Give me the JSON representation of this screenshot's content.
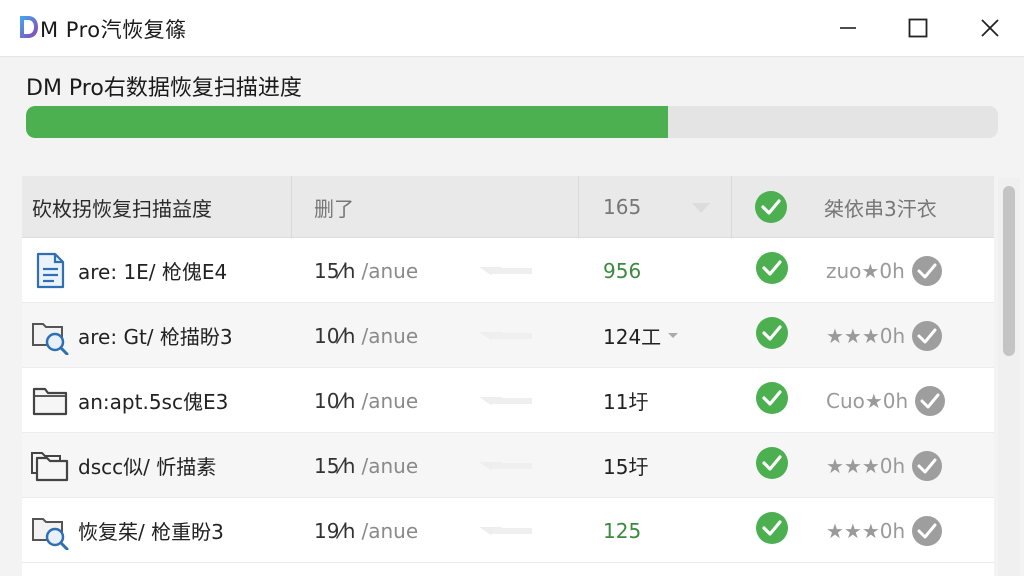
{
  "window": {
    "title": "M Pro汽恢复篠",
    "logo_letter": "D",
    "minimize_icon": "minimize-icon",
    "maximize_icon": "maximize-icon",
    "close_icon": "close-icon"
  },
  "scan": {
    "title": "DM Pro右数据恢复扫描进度",
    "progress": 0.66
  },
  "table": {
    "headers": [
      "砍枚拐恢复扫描益度",
      "删了",
      "165",
      "",
      "桀依串3汗衣"
    ],
    "rows": [
      {
        "icon": "document-icon",
        "name": "are: 1E/ 枪傀E4",
        "size": "15⁄h",
        "date": "/anue",
        "count": "956",
        "count_green": true,
        "has_dropdown": false,
        "check": true,
        "rating": "zuo★0h"
      },
      {
        "icon": "folder-search-icon",
        "name": "are: Gt/ 枪描盼3",
        "size": "10⁄h",
        "date": "/anue",
        "count": "124工",
        "count_green": false,
        "has_dropdown": true,
        "check": true,
        "rating": "★★★0h"
      },
      {
        "icon": "folder-icon",
        "name": "an:apt.5sc傀E3",
        "size": "10⁄h",
        "date": "/anue",
        "count": "11圩",
        "count_green": false,
        "has_dropdown": false,
        "check": true,
        "rating": "Cuo★0h"
      },
      {
        "icon": "folders-icon",
        "name": "dscc似/ 忻描素",
        "size": "15⁄h",
        "date": "/anue",
        "count": "15圩",
        "count_green": false,
        "has_dropdown": false,
        "check": true,
        "rating": "★★★0h"
      },
      {
        "icon": "folder-search-icon",
        "name": "恢复茱/ 枪重盼3",
        "size": "19⁄h",
        "date": "/anue",
        "count": "125",
        "count_green": true,
        "has_dropdown": false,
        "check": true,
        "rating": "★★★0h"
      }
    ]
  },
  "colors": {
    "accent_green": "#4caf50",
    "check_green": "#4caf50",
    "check_gray": "#9e9e9e",
    "file_blue": "#2f6fb3"
  }
}
